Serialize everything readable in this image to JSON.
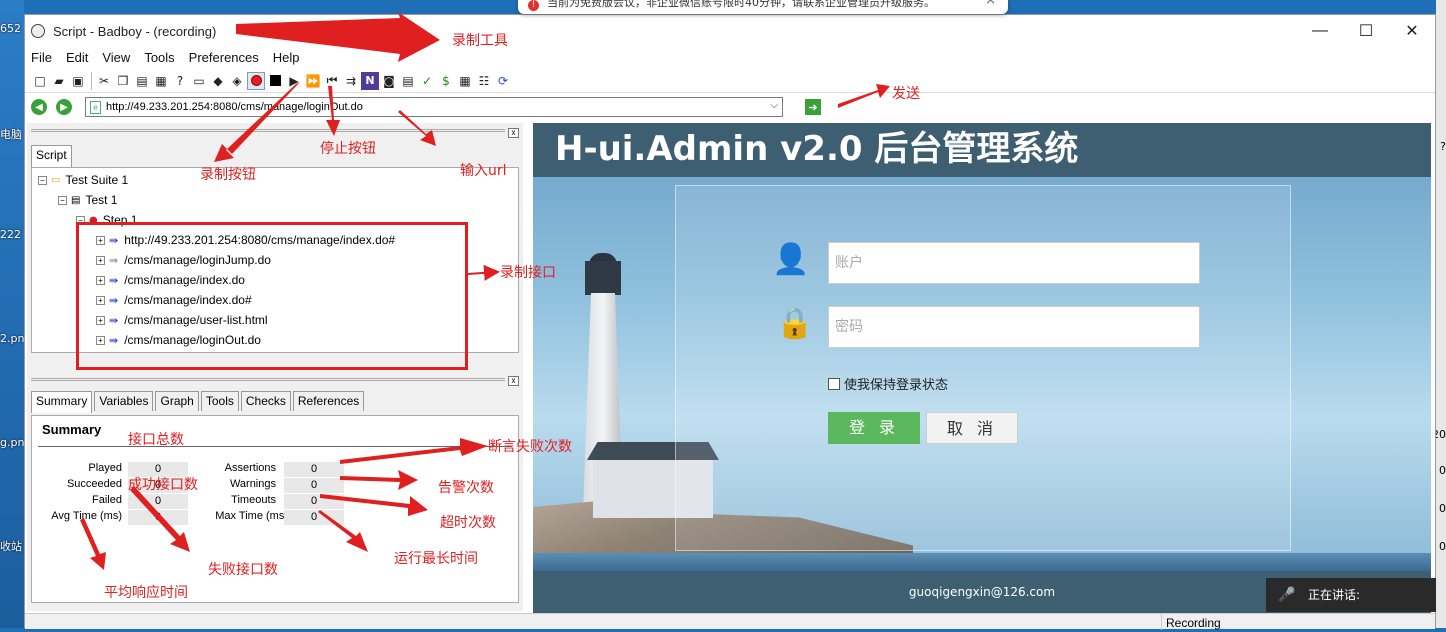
{
  "desktop": {
    "left_labels": [
      "652",
      "电脑",
      "222",
      "2.pn",
      "g.pn",
      "收站"
    ],
    "right_labels": [
      "?",
      "20",
      "0",
      "0",
      "0"
    ]
  },
  "notice": {
    "text": "当前为免费版会议，非企业微信账号限时40分钟，请联系企业管理员升级服务。",
    "close": "×"
  },
  "window": {
    "title": "Script - Badboy - (recording)",
    "min": "—",
    "max": "☐",
    "close": "✕"
  },
  "menu": [
    "File",
    "Edit",
    "View",
    "Tools",
    "Preferences",
    "Help"
  ],
  "toolbar_icons": [
    "new-icon",
    "open-icon",
    "save-icon",
    "cut-icon",
    "copy-icon",
    "paste-icon",
    "print-icon",
    "help-icon",
    "add-suite-icon",
    "add-test-icon",
    "add-step-icon",
    "record-icon",
    "stop-icon",
    "play-icon",
    "play-all-icon",
    "rewind-icon",
    "step-icon",
    "navigation-icon",
    "screenshot-icon",
    "report-icon",
    "assertion-icon",
    "variable-icon",
    "table-icon",
    "tree-icon",
    "refresh-icon"
  ],
  "url": {
    "value": "http://49.233.201.254:8080/cms/manage/loginOut.do"
  },
  "script_panel": {
    "tab": "Script",
    "suite": "Test Suite 1",
    "test": "Test 1",
    "step": "Step 1",
    "items": [
      "http://49.233.201.254:8080/cms/manage/index.do#",
      "/cms/manage/loginJump.do",
      "/cms/manage/index.do",
      "/cms/manage/index.do#",
      "/cms/manage/user-list.html",
      "/cms/manage/loginOut.do"
    ]
  },
  "summary_panel": {
    "tabs": [
      "Summary",
      "Variables",
      "Graph",
      "Tools",
      "Checks",
      "References"
    ],
    "title": "Summary",
    "left": [
      {
        "label": "Played",
        "value": "0"
      },
      {
        "label": "Succeeded",
        "value": "0"
      },
      {
        "label": "Failed",
        "value": "0"
      },
      {
        "label": "Avg Time (ms)",
        "value": "0"
      }
    ],
    "right": [
      {
        "label": "Assertions",
        "value": "0"
      },
      {
        "label": "Warnings",
        "value": "0"
      },
      {
        "label": "Timeouts",
        "value": "0"
      },
      {
        "label": "Max Time (ms)",
        "value": "0"
      }
    ]
  },
  "browser": {
    "header": "H-ui.Admin v2.0 后台管理系统",
    "account_placeholder": "账户",
    "password_placeholder": "密码",
    "remember": "使我保持登录状态",
    "login": "登录",
    "cancel": "取消",
    "footer": "guoqigengxin@126.com"
  },
  "status": {
    "text": "Recording"
  },
  "speaking": {
    "text": "正在讲话:"
  },
  "annotations": {
    "record_tool": "录制工具",
    "send": "发送",
    "stop_button": "停止按钮",
    "input_url": "输入url",
    "record_button": "录制按钮",
    "record_api": "录制接口",
    "api_total": "接口总数",
    "assert_fail": "断言失败次数",
    "success_api": "成功接口数",
    "warning_count": "告警次数",
    "timeout_count": "超时次数",
    "max_time": "运行最长时间",
    "fail_api": "失败接口数",
    "avg_time": "平均响应时间"
  }
}
